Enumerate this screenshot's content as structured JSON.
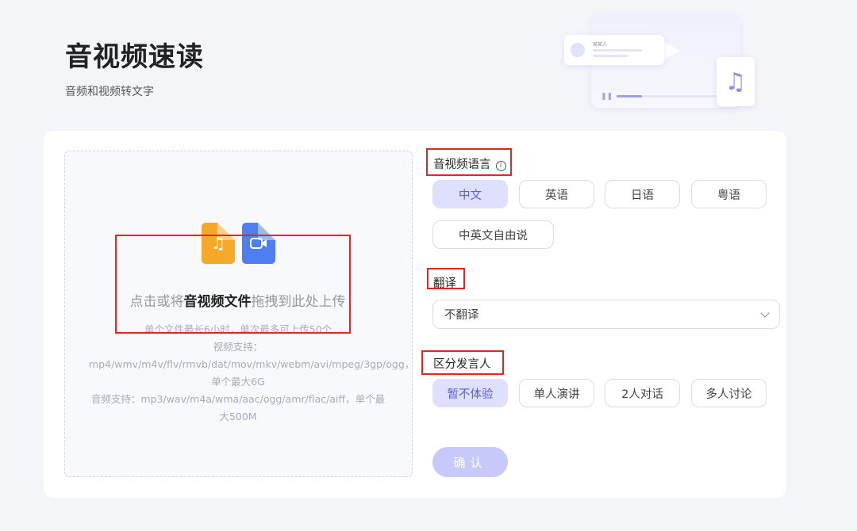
{
  "header": {
    "title": "音视频速读",
    "subtitle": "音频和视频转文字"
  },
  "illustration": {
    "card_label": "某某人"
  },
  "upload": {
    "hint_prefix": "点击或将",
    "hint_bold": "音视频文件",
    "hint_suffix": "拖拽到此处上传",
    "rules": [
      "单个文件最长6小时，单次最多可上传50个",
      "视频支持：mp4/wmv/m4v/flv/rmvb/dat/mov/mkv/webm/avi/mpeg/3gp/ogg，单个最大6G",
      "音频支持：mp3/wav/m4a/wma/aac/ogg/amr/flac/aiff，单个最大500M"
    ]
  },
  "language": {
    "label": "音视频语言",
    "info_icon": "info-icon",
    "options": [
      "中文",
      "英语",
      "日语",
      "粤语",
      "中英文自由说"
    ],
    "selected": "中文"
  },
  "translation": {
    "label": "翻译",
    "value": "不翻译"
  },
  "speaker": {
    "label": "区分发言人",
    "options": [
      "暂不体验",
      "单人演讲",
      "2人对话",
      "多人讨论"
    ],
    "selected": "暂不体验"
  },
  "confirm": {
    "label": "确认"
  },
  "colors": {
    "accent": "#5b5fd3",
    "selected_bg": "#dfe0fe",
    "confirm_bg": "#c8c9fb",
    "annotation_red": "#e3261f",
    "audio_icon": "#f6a929",
    "video_icon": "#4f7df2"
  }
}
